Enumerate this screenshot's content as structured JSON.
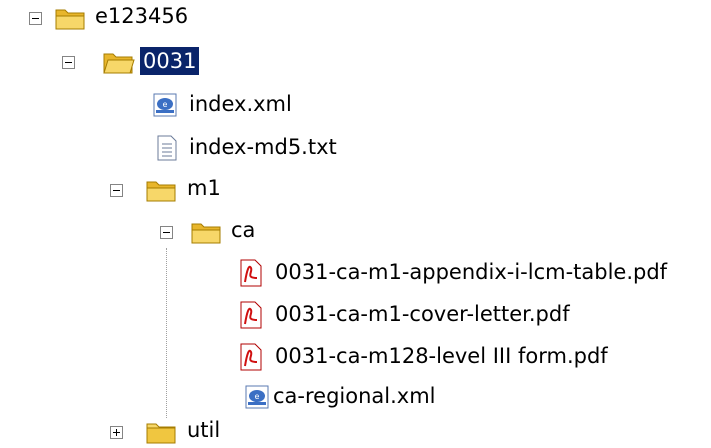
{
  "tree": {
    "root": {
      "label": "e123456"
    },
    "n0031": {
      "label": "0031"
    },
    "index_xml": {
      "label": "index.xml"
    },
    "index_md5": {
      "label": "index-md5.txt"
    },
    "m1": {
      "label": "m1"
    },
    "ca": {
      "label": "ca"
    },
    "pdf1": {
      "label": "0031-ca-m1-appendix-i-lcm-table.pdf"
    },
    "pdf2": {
      "label": "0031-ca-m1-cover-letter.pdf"
    },
    "pdf3": {
      "label": "0031-ca-m128-level III form.pdf"
    },
    "ca_regional": {
      "label": "ca-regional.xml"
    },
    "util": {
      "label": "util"
    }
  },
  "colors": {
    "selection": "#0a246a",
    "folder": "#f0c640",
    "pdf": "#d01010",
    "xml": "#1a5fb4"
  }
}
